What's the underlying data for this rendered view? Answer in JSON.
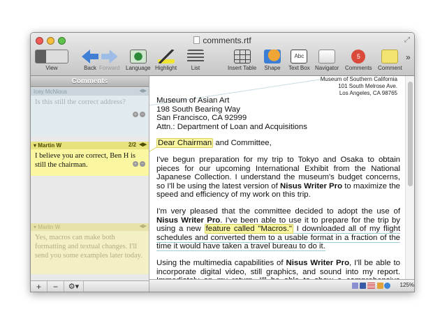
{
  "window": {
    "title": "comments.rtf"
  },
  "toolbar": {
    "view": "View",
    "back": "Back",
    "forward": "Forward",
    "language": "Language",
    "highlight": "Highlight",
    "list": "List",
    "insert_table": "Insert Table",
    "shape": "Shape",
    "text_box": "Text Box",
    "navigator": "Navigator",
    "comments": "Comments",
    "comment": "Comment",
    "comments_badge": "5",
    "overflow": "»"
  },
  "sidebar": {
    "title": "Comments",
    "comments": [
      {
        "author": "Icey McNious",
        "text": "Is this still the correct address?"
      },
      {
        "author": "Martin W",
        "page": "2/2",
        "text": "I believe you are correct, Ben H is still the chairman."
      },
      {
        "author": "Martin W",
        "text": "Yes, macros can make both formatting and textual changes. I'll send you some examples later today."
      }
    ],
    "add": "+",
    "remove": "−",
    "gear": "⚙▾"
  },
  "document": {
    "address_right": [
      "Museum of Southern California",
      "101 South Melrose Ave.",
      "Los Angeles, CA 98765"
    ],
    "address_left": [
      "Museum of Asian Art",
      "198 South Bearing Way",
      "San Francisco, CA 92999",
      "Attn.: Department of Loan and Acquisitions"
    ],
    "salutation_hl": "Dear Chairman",
    "salutation_rest": " and Committee,",
    "p1": "I've begun preparation for my trip to Tokyo and Osaka to obtain pieces for our upcoming International Exhibit from the National Japanese Collection. I understand the museum's budget concerns, so I'll be using the latest version of ",
    "p1_bold": "Nisus Writer Pro",
    "p1_end": " to maximize the speed and efficiency of my work on this trip.",
    "p2_a": "I'm very pleased that the committee decided to adopt the use of ",
    "p2_bold1": "Nisus Writer Pro",
    "p2_b": ". I've been able to use it to prepare for the trip by using a new ",
    "p2_hl": "feature called \"Macros.\"",
    "p2_c": " I downloaded all of my flight schedules and converted them to a usable format in a fraction of the time it would have taken a travel bureau to do it.",
    "p3_a": "Using the multimedia capabilities of ",
    "p3_bold": "Nisus Writer Pro",
    "p3_b": ", I'll be able to incorporate digital video, still graphics, and sound into my report. Immediately on my return, I'll be able to show a comprehensive audio"
  },
  "status": {
    "zoom": "125%"
  },
  "colors": {
    "comment_yellow": "#fbf6a0",
    "comment_blue": "#e1ebef"
  }
}
